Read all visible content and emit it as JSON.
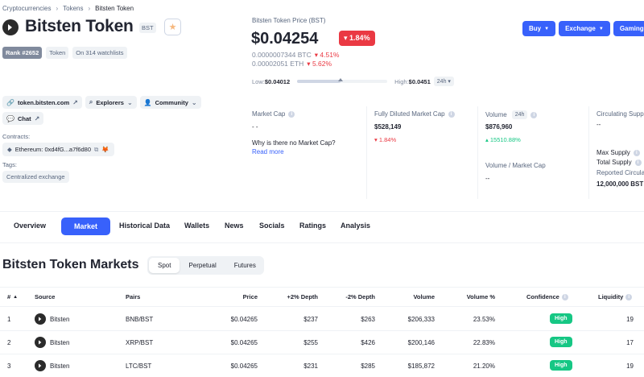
{
  "breadcrumb": [
    "Cryptocurrencies",
    "Tokens",
    "Bitsten Token"
  ],
  "coin": {
    "name": "Bitsten Token",
    "symbol": "BST",
    "rank": "Rank #2652",
    "type": "Token",
    "watchlists": "On 314 watchlists"
  },
  "price": {
    "label": "Bitsten Token Price (BST)",
    "value": "$0.04254",
    "change": "1.84%",
    "btc_value": "0.0000007344 BTC",
    "btc_change": "4.51%",
    "eth_value": "0.00002051 ETH",
    "eth_change": "5.62%",
    "low_label": "Low:",
    "low": "$0.04012",
    "high_label": "High:",
    "high": "$0.0451",
    "range_period": "24h",
    "range_position": 0.48
  },
  "actions": [
    "Buy",
    "Exchange",
    "Gaming",
    ""
  ],
  "links": {
    "website": "token.bitsten.com",
    "explorers": "Explorers",
    "community": "Community",
    "chat": "Chat",
    "contracts_label": "Contracts:",
    "contract": "Ethereum: 0xd4fG...a7f6d80",
    "tags_label": "Tags:",
    "tag": "Centralized exchange"
  },
  "stats": {
    "market_cap": {
      "label": "Market Cap",
      "value": "- -",
      "question": "Why is there no Market Cap?",
      "read_more": "Read more"
    },
    "fdmc": {
      "label": "Fully Diluted Market Cap",
      "value": "$528,149",
      "change": "1.84%"
    },
    "volume": {
      "label": "Volume",
      "period": "24h",
      "value": "$876,960",
      "change": "15510.88%"
    },
    "vol_mcap": {
      "label": "Volume / Market Cap",
      "value": "--"
    },
    "circulating": {
      "label": "Circulating Supp",
      "value": "--"
    },
    "max_supply": {
      "label": "Max Supply"
    },
    "total_supply": {
      "label": "Total Supply"
    },
    "reported": {
      "label": "Reported Circula",
      "value": "12,000,000 BST"
    }
  },
  "tabs": [
    "Overview",
    "Market",
    "Historical Data",
    "Wallets",
    "News",
    "Socials",
    "Ratings",
    "Analysis"
  ],
  "markets": {
    "title": "Bitsten Token Markets",
    "segments": [
      "Spot",
      "Perpetual",
      "Futures"
    ],
    "columns": [
      "#",
      "Source",
      "Pairs",
      "Price",
      "+2% Depth",
      "-2% Depth",
      "Volume",
      "Volume %",
      "Confidence",
      "Liquidity"
    ],
    "rows": [
      {
        "rank": "1",
        "source": "Bitsten",
        "pair": "BNB/BST",
        "price": "$0.04265",
        "plus_depth": "$237",
        "minus_depth": "$263",
        "volume": "$206,333",
        "volume_pct": "23.53%",
        "confidence": "High",
        "liquidity": "19"
      },
      {
        "rank": "2",
        "source": "Bitsten",
        "pair": "XRP/BST",
        "price": "$0.04265",
        "plus_depth": "$255",
        "minus_depth": "$426",
        "volume": "$200,146",
        "volume_pct": "22.83%",
        "confidence": "High",
        "liquidity": "17"
      },
      {
        "rank": "3",
        "source": "Bitsten",
        "pair": "LTC/BST",
        "price": "$0.04265",
        "plus_depth": "$231",
        "minus_depth": "$285",
        "volume": "$185,872",
        "volume_pct": "21.20%",
        "confidence": "High",
        "liquidity": "19"
      }
    ]
  },
  "colors": {
    "accent": "#3861fb",
    "negative": "#ea3943",
    "positive": "#16c784"
  }
}
